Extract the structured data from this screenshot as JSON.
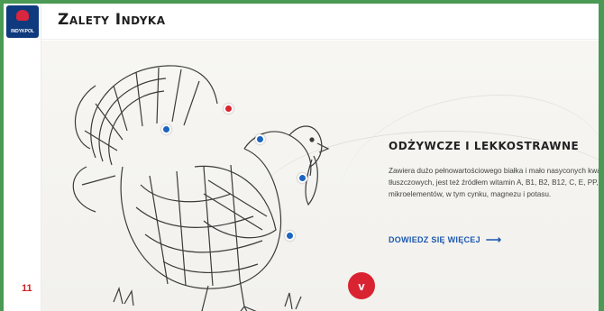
{
  "brand": {
    "logo_text": "INDYKPOL"
  },
  "header": {
    "title": "Zalety Indyka"
  },
  "info": {
    "title": "ODŻYWCZE I LEKKOSTRAWNE",
    "description": "Zawiera dużo pełnowartościowego białka i mało nasyconych kwasów tłuszczowych, jest też źródłem witamin A, B1, B2, B12, C, E, PP, a także mikroelementów, w tym cynku, magnezu i potasu.",
    "more_link": "DOWIEDZ SIĘ WIĘCEJ"
  },
  "next_button": {
    "label": "v"
  },
  "corner_badge": "11",
  "icons": {
    "logo": "indykpol-logo-icon",
    "arrow": "arrow-right-icon",
    "turkey": "turkey-illustration-icon"
  },
  "colors": {
    "accent_blue": "#1b64c0",
    "accent_red": "#d92331",
    "brand_navy": "#0f3a7d"
  }
}
